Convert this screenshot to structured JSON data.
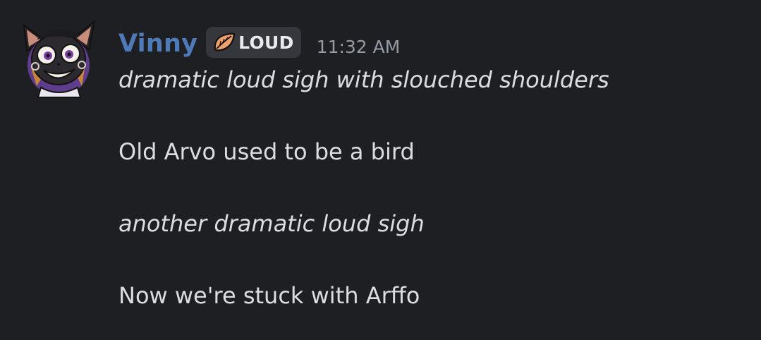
{
  "message": {
    "author": "Vinny",
    "author_color": "#4f7ab8",
    "role_tag": {
      "icon": "leaf-icon",
      "label": "LOUD"
    },
    "timestamp": "11:32 AM",
    "lines": [
      {
        "text": "dramatic loud sigh with slouched shoulders",
        "style": "italic"
      },
      {
        "text": "Old Arvo used to be a bird",
        "style": "normal"
      },
      {
        "text": "another dramatic loud sigh",
        "style": "italic"
      },
      {
        "text": "Now we're stuck with Arffo",
        "style": "normal"
      }
    ]
  },
  "colors": {
    "background": "#1e1f23",
    "text": "#dbdee1",
    "timestamp": "#949ba4",
    "tag_background": "#35373d"
  }
}
